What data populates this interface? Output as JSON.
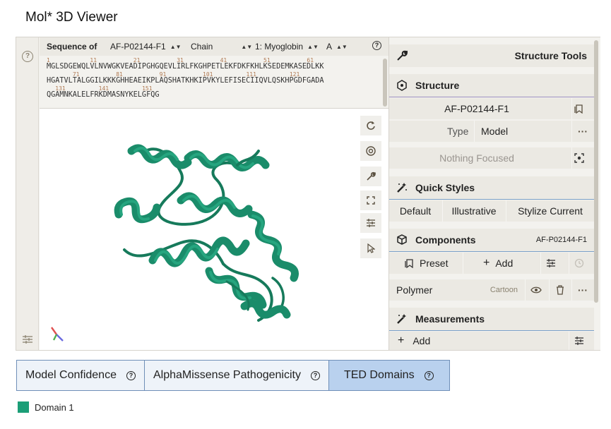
{
  "page": {
    "title": "Mol* 3D Viewer"
  },
  "colors": {
    "domain": "#1b9e77",
    "protein": "#1a8c6a",
    "active_tab": "#b9d1ee",
    "tab_border": "#6f8fb8",
    "separator_purple": "#9b8fc0",
    "separator_blue": "#7aa0c8"
  },
  "sequence": {
    "label": "Sequence of",
    "entry": "AF-P02144-F1",
    "mode": "Chain",
    "entity": "1: Myoglobin",
    "chain": "A",
    "numbers_row1": [
      "1",
      "11",
      "21",
      "31",
      "41",
      "51",
      "61"
    ],
    "line1": "MGLSDGEWQLVLNVWGKVEADIPGHGQEVLIRLFKGHPETLEKFDKFKHLKSEDEMKASEDLKK",
    "numbers_row2": [
      "71",
      "81",
      "91",
      "101",
      "111",
      "121"
    ],
    "line2": "HGATVLTALGGILKKKGHHEAEIKPLAQSHATKHKIPVKYLEFISECIIQVLQSKHPGDFGADA",
    "numbers_row3": [
      "131",
      "141",
      "151"
    ],
    "line3": "QGAMNKALELFRKDMASNYKELGFQG"
  },
  "left_strip": {
    "help_icon": "help-circle-icon",
    "settings_icon": "sliders-icon"
  },
  "canvas_tools": [
    "reset-camera-icon",
    "screenshot-icon",
    "tools-icon",
    "fullscreen-icon",
    "settings-icon",
    "selection-mode-icon"
  ],
  "structure_tools": {
    "title": "Structure Tools",
    "structure": {
      "title": "Structure",
      "entry": "AF-P02144-F1",
      "type_label": "Type",
      "type_value": "Model",
      "focus": "Nothing Focused"
    },
    "quick_styles": {
      "title": "Quick Styles",
      "options": [
        "Default",
        "Illustrative",
        "Stylize Current"
      ]
    },
    "components": {
      "title": "Components",
      "entry": "AF-P02144-F1",
      "preset_label": "Preset",
      "add_label": "Add",
      "polymer_label": "Polymer",
      "polymer_repr": "Cartoon"
    },
    "measurements": {
      "title": "Measurements",
      "add_label": "Add"
    }
  },
  "tabs": [
    {
      "label": "Model Confidence",
      "active": false
    },
    {
      "label": "AlphaMissense Pathogenicity",
      "active": false
    },
    {
      "label": "TED Domains",
      "active": true
    }
  ],
  "legend": [
    {
      "label": "Domain 1",
      "color": "#1b9e77"
    }
  ]
}
